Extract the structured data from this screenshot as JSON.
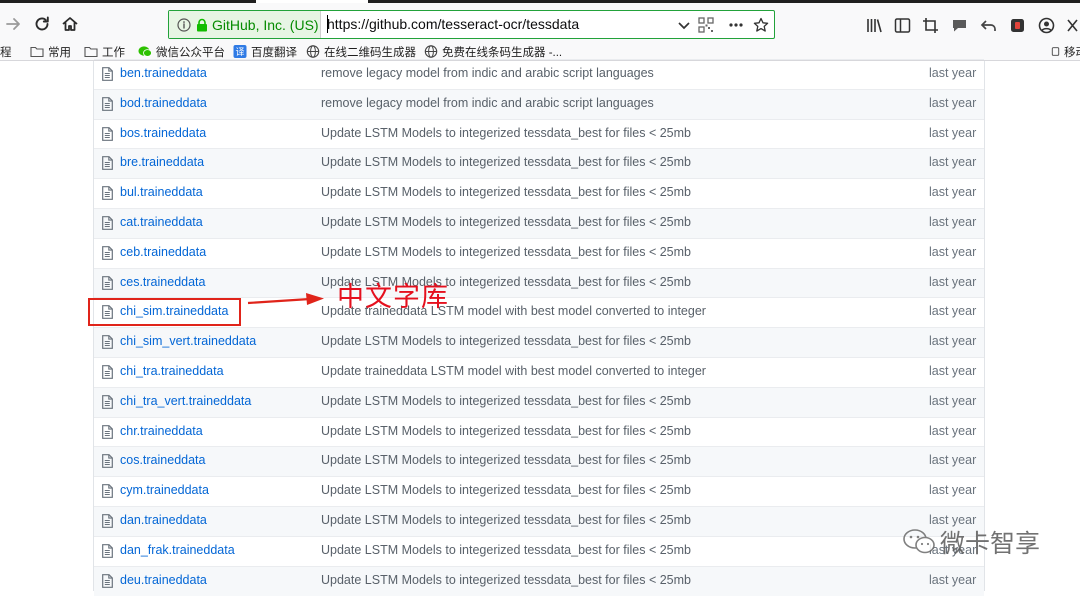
{
  "browser": {
    "identity_label": "GitHub, Inc. (US)",
    "url": "https://github.com/tesseract-ocr/tessdata"
  },
  "bookmarks": [
    {
      "label": "程",
      "icon": "folder-icon"
    },
    {
      "label": "常用",
      "icon": "folder-icon"
    },
    {
      "label": "工作",
      "icon": "folder-icon"
    },
    {
      "label": "微信公众平台",
      "icon": "wechat-icon"
    },
    {
      "label": "百度翻译",
      "icon": "translate-icon"
    },
    {
      "label": "在线二维码生成器",
      "icon": "globe-icon"
    },
    {
      "label": "免费在线条码生成器 -...",
      "icon": "globe-icon"
    },
    {
      "label": "移动",
      "icon": "mobile-icon"
    }
  ],
  "files": [
    {
      "name": "ben.traineddata",
      "message": "remove legacy model from indic and arabic script languages",
      "age": "last year"
    },
    {
      "name": "bod.traineddata",
      "message": "remove legacy model from indic and arabic script languages",
      "age": "last year"
    },
    {
      "name": "bos.traineddata",
      "message": "Update LSTM Models to integerized tessdata_best for files < 25mb",
      "age": "last year"
    },
    {
      "name": "bre.traineddata",
      "message": "Update LSTM Models to integerized tessdata_best for files < 25mb",
      "age": "last year"
    },
    {
      "name": "bul.traineddata",
      "message": "Update LSTM Models to integerized tessdata_best for files < 25mb",
      "age": "last year"
    },
    {
      "name": "cat.traineddata",
      "message": "Update LSTM Models to integerized tessdata_best for files < 25mb",
      "age": "last year"
    },
    {
      "name": "ceb.traineddata",
      "message": "Update LSTM Models to integerized tessdata_best for files < 25mb",
      "age": "last year"
    },
    {
      "name": "ces.traineddata",
      "message": "Update LSTM Models to integerized tessdata_best for files < 25mb",
      "age": "last year"
    },
    {
      "name": "chi_sim.traineddata",
      "message": "Update traineddata LSTM model with best model converted to integer",
      "age": "last year"
    },
    {
      "name": "chi_sim_vert.traineddata",
      "message": "Update LSTM Models to integerized tessdata_best for files < 25mb",
      "age": "last year"
    },
    {
      "name": "chi_tra.traineddata",
      "message": "Update traineddata LSTM model with best model converted to integer",
      "age": "last year"
    },
    {
      "name": "chi_tra_vert.traineddata",
      "message": "Update LSTM Models to integerized tessdata_best for files < 25mb",
      "age": "last year"
    },
    {
      "name": "chr.traineddata",
      "message": "Update LSTM Models to integerized tessdata_best for files < 25mb",
      "age": "last year"
    },
    {
      "name": "cos.traineddata",
      "message": "Update LSTM Models to integerized tessdata_best for files < 25mb",
      "age": "last year"
    },
    {
      "name": "cym.traineddata",
      "message": "Update LSTM Models to integerized tessdata_best for files < 25mb",
      "age": "last year"
    },
    {
      "name": "dan.traineddata",
      "message": "Update LSTM Models to integerized tessdata_best for files < 25mb",
      "age": "last year"
    },
    {
      "name": "dan_frak.traineddata",
      "message": "Update LSTM Models to integerized tessdata_best for files < 25mb",
      "age": "last year"
    },
    {
      "name": "deu.traineddata",
      "message": "Update LSTM Models to integerized tessdata_best for files < 25mb",
      "age": "last year"
    }
  ],
  "annotation": {
    "label": "中文字库",
    "color": "#e5101e"
  },
  "watermark": {
    "text": "微卡智享"
  },
  "colors": {
    "link": "#0366d6",
    "secure_green": "#058b00"
  }
}
